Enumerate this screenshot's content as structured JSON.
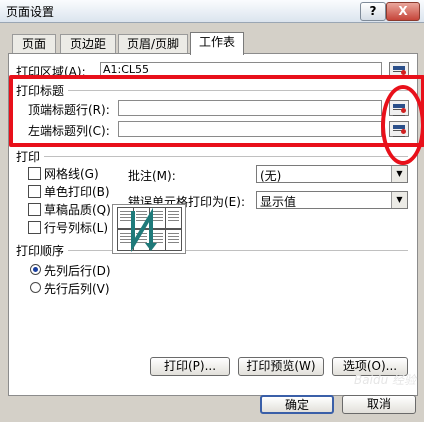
{
  "window": {
    "title": "页面设置",
    "help_label": "?",
    "close_label": "X"
  },
  "tabs": [
    {
      "label": "页面"
    },
    {
      "label": "页边距"
    },
    {
      "label": "页眉/页脚"
    },
    {
      "label": "工作表"
    }
  ],
  "print_area": {
    "label": "打印区域(A):",
    "value": "A1:CL55"
  },
  "print_titles": {
    "heading": "打印标题",
    "top_rows_label": "顶端标题行(R):",
    "top_rows_value": "",
    "left_cols_label": "左端标题列(C):",
    "left_cols_value": ""
  },
  "print": {
    "heading": "打印",
    "checkboxes": [
      {
        "label": "网格线(G)"
      },
      {
        "label": "单色打印(B)"
      },
      {
        "label": "草稿品质(Q)"
      },
      {
        "label": "行号列标(L)"
      }
    ],
    "comments_label": "批注(M):",
    "comments_value": "(无)",
    "errors_label": "错误单元格打印为(E):",
    "errors_value": "显示值"
  },
  "page_order": {
    "heading": "打印顺序",
    "options": [
      {
        "label": "先列后行(D)",
        "selected": true
      },
      {
        "label": "先行后列(V)",
        "selected": false
      }
    ]
  },
  "buttons": {
    "print": "打印(P)...",
    "print_preview": "打印预览(W)",
    "options": "选项(O)...",
    "ok": "确定",
    "cancel": "取消"
  },
  "watermark": "Baidu 经验"
}
